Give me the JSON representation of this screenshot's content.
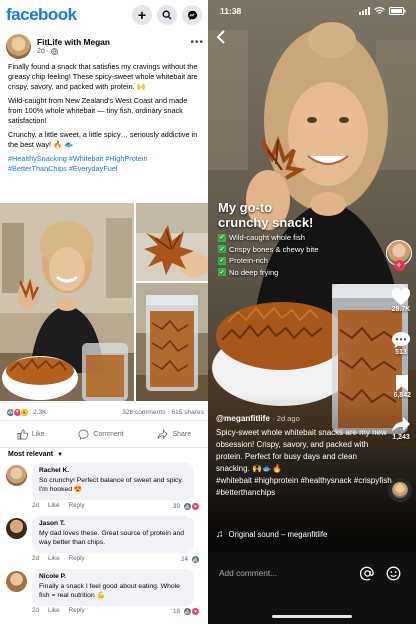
{
  "facebook": {
    "logo": "facebook",
    "post": {
      "author": "FitLife with Megan",
      "time": "2d",
      "paragraphs": [
        "Finally found a snack that satisfies my cravings without the greasy chip feeling! These spicy-sweet whole whitebait are crispy, savory, and packed with protein. 🙌",
        "Wild-caught from New Zealand's West Coast and made from 100% whole whitebait — tiny fish, ordinary snack satisfaction!",
        "Crunchy, a little sweet, a little spicy… seriously addictive in the best way! 🔥 🐟"
      ],
      "hashtags_line1": "#HealthySnacking #Whitebait #HighProtein",
      "hashtags_line2": "#BetterThanChips #EverydayFuel"
    },
    "reactions": {
      "count": "2.3K",
      "comments": "328 comments",
      "shares": "615 shares"
    },
    "actions": {
      "like": "Like",
      "comment": "Comment",
      "share": "Share"
    },
    "sort_label": "Most relevant",
    "comments": [
      {
        "name": "Rachel K.",
        "text": "So crunchy! Perfect balance of sweet and spicy. I'm hooked 😍",
        "time": "2d",
        "like": "Like",
        "reply": "Reply",
        "count": "39"
      },
      {
        "name": "Jason T.",
        "text": "My dad loves these. Great source of protein and way better than chips.",
        "time": "2d",
        "like": "Like",
        "reply": "Reply",
        "count": "24"
      },
      {
        "name": "Nicole P.",
        "text": "Finally a snack I feel good about eating. Whole fish = real nutrition 💪",
        "time": "2d",
        "like": "Like",
        "reply": "Reply",
        "count": "18"
      }
    ],
    "colors": {
      "brand": "#1877f2",
      "like_blue": "#1877f2",
      "love_red": "#f33e58"
    }
  },
  "tiktok": {
    "time": "11:38",
    "overlay": {
      "title_line1": "My go-to",
      "title_line2": "crunchy snack!",
      "checks": [
        "Wild-caught whole fish",
        "Crispy bones & chewy bite",
        "Protein-rich",
        "No deep frying"
      ]
    },
    "rail": {
      "likes": "28.7K",
      "comments": "513",
      "saves": "6,842",
      "shares": "1,243"
    },
    "caption": {
      "user": "@meganfitlife",
      "ago": "· 2d ago",
      "text": "Spicy-sweet whole whitebait snacks are my new obsession! Crispy, savory, and packed with protein. Perfect for busy days and clean snacking. 🙌🐟🔥",
      "hashtags": "#whitebait #highprotein #healthysnack #crispyfish #betterthanchips"
    },
    "sound": "Original sound – meganfitlife",
    "comment_placeholder": "Add comment..."
  }
}
